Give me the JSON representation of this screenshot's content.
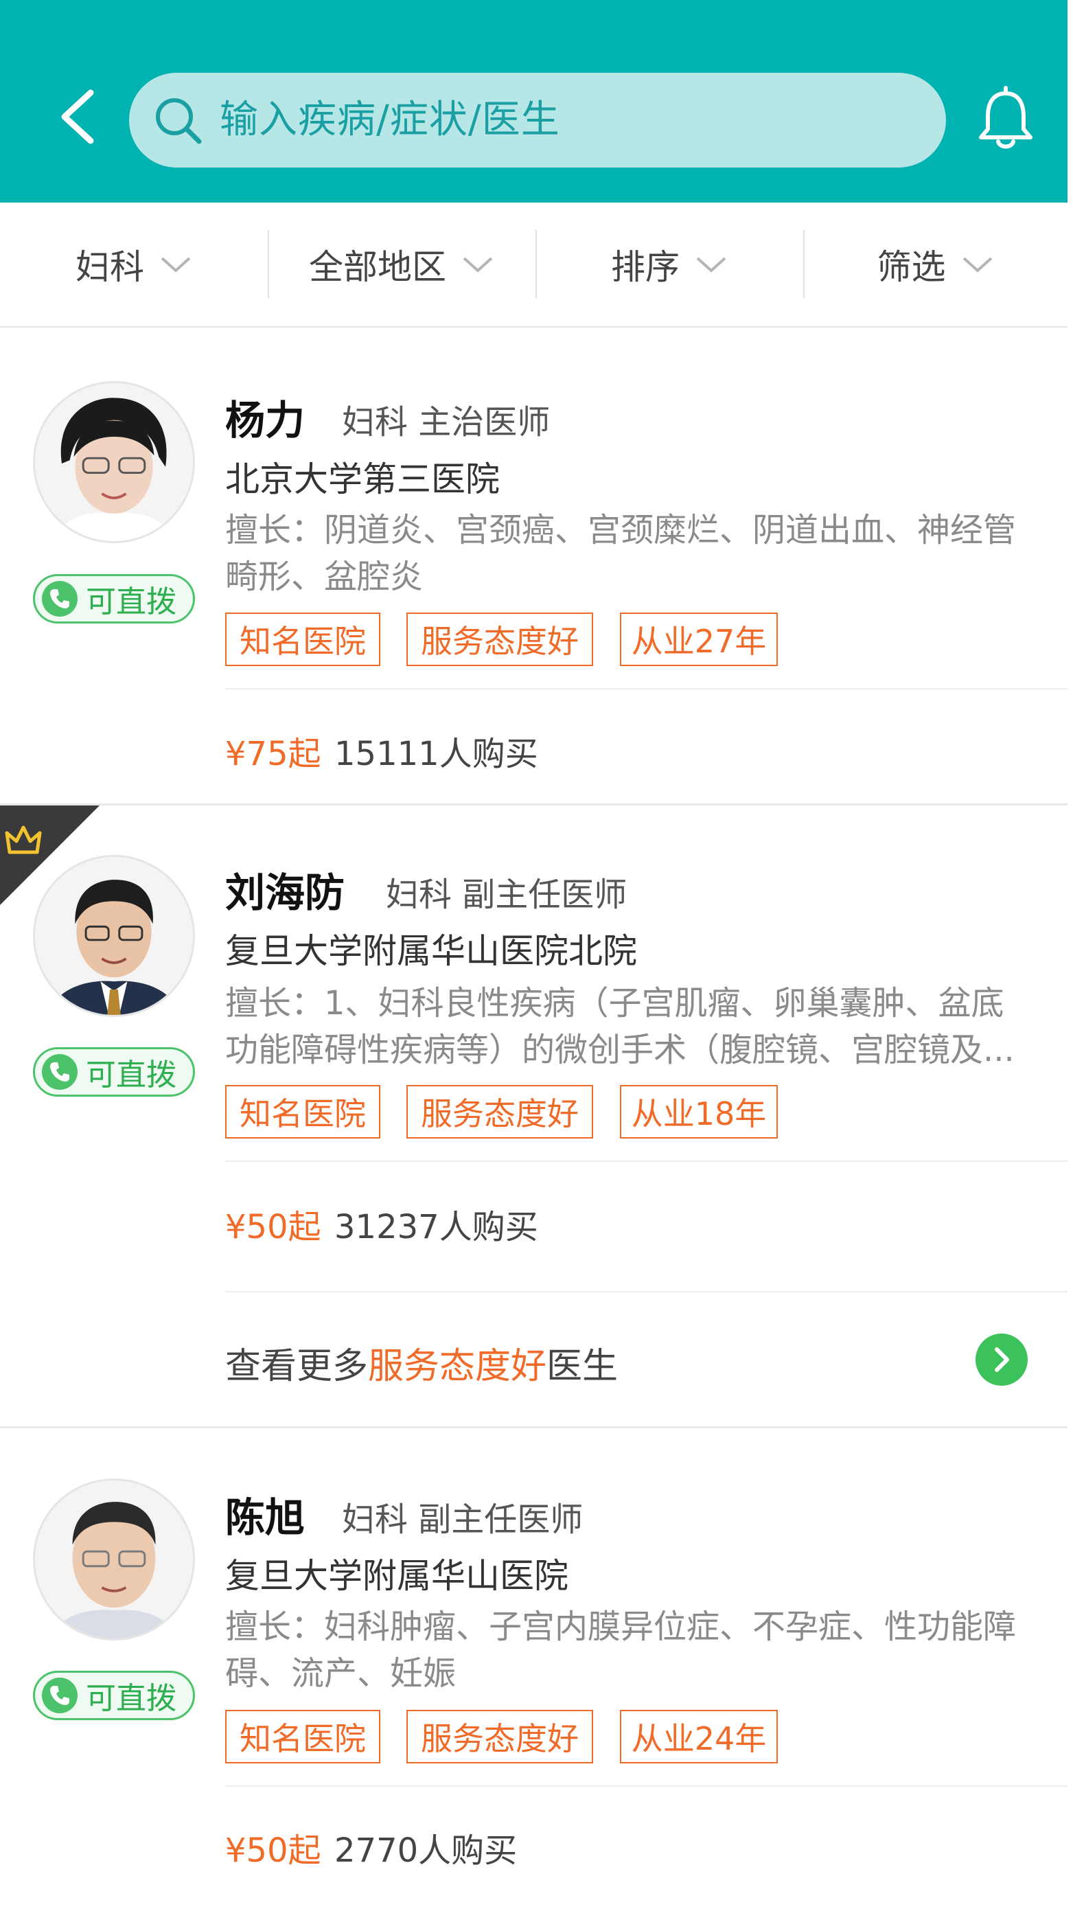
{
  "colors": {
    "primary": "#00b2b0",
    "accent": "#f06a28",
    "call_green": "#4cc36a"
  },
  "header": {
    "back_icon": "chevron-left-icon",
    "search_placeholder": "输入疾病/症状/医生",
    "search_icon": "search-icon",
    "bell_icon": "bell-icon"
  },
  "filters": [
    {
      "label": "妇科"
    },
    {
      "label": "全部地区"
    },
    {
      "label": "排序"
    },
    {
      "label": "筛选"
    }
  ],
  "call_label": "可直拨",
  "doctors": [
    {
      "name": "杨力",
      "dept": "妇科  主治医师",
      "hospital": "北京大学第三医院",
      "skill": "擅长：阴道炎、宫颈癌、宫颈糜烂、阴道出血、神经管畸形、盆腔炎",
      "tags": [
        "知名医院",
        "服务态度好",
        "从业27年"
      ],
      "price": "¥75起",
      "buyers": "15111人购买"
    },
    {
      "name": "刘海防",
      "dept": "妇科  副主任医师",
      "hospital": "复旦大学附属华山医院北院",
      "skill_line1": "擅长：1、妇科良性疾病（子宫肌瘤、卵巢囊肿、盆底",
      "skill_line2": "功能障碍性疾病等）的微创手术（腹腔镜、宫腔镜及...",
      "tags": [
        "知名医院",
        "服务态度好",
        "从业18年"
      ],
      "price": "¥50起",
      "buyers": "31237人购买",
      "featured_icon": "crown-icon"
    },
    {
      "name": "陈旭",
      "dept": "妇科  副主任医师",
      "hospital": "复旦大学附属华山医院",
      "skill": "擅长：妇科肿瘤、子宫内膜异位症、不孕症、性功能障碍、流产、妊娠",
      "tags": [
        "知名医院",
        "服务态度好",
        "从业24年"
      ],
      "price": "¥50起",
      "buyers": "2770人购买"
    }
  ],
  "more": {
    "prefix": "查看更多",
    "highlight": "服务态度好",
    "suffix": "医生"
  }
}
